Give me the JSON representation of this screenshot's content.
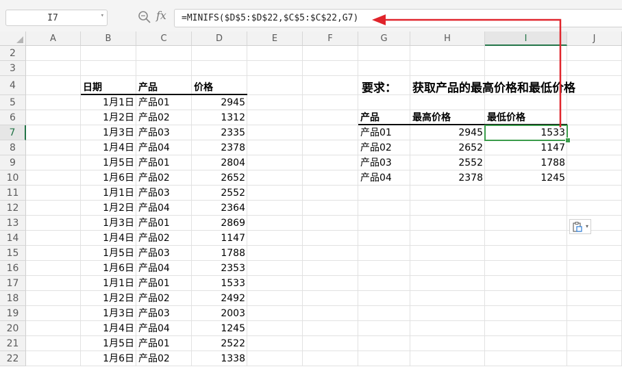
{
  "formula_bar": {
    "name_box": "I7",
    "fx_label": "fx",
    "formula": "=MINIFS($D$5:$D$22,$C$5:$C$22,G7)"
  },
  "columns": [
    "A",
    "B",
    "C",
    "D",
    "E",
    "F",
    "G",
    "H",
    "I",
    "J"
  ],
  "selected_column": "I",
  "rows": [
    "2",
    "3",
    "4",
    "5",
    "6",
    "7",
    "8",
    "9",
    "10",
    "11",
    "12",
    "13",
    "14",
    "15",
    "16",
    "17",
    "18",
    "19",
    "20",
    "21",
    "22"
  ],
  "selected_row": "7",
  "source_table": {
    "headers": [
      "日期",
      "产品",
      "价格"
    ],
    "rows": [
      [
        "1月1日",
        "产品01",
        "2945"
      ],
      [
        "1月2日",
        "产品02",
        "1312"
      ],
      [
        "1月3日",
        "产品03",
        "2335"
      ],
      [
        "1月4日",
        "产品04",
        "2378"
      ],
      [
        "1月5日",
        "产品01",
        "2804"
      ],
      [
        "1月6日",
        "产品02",
        "2652"
      ],
      [
        "1月1日",
        "产品03",
        "2552"
      ],
      [
        "1月2日",
        "产品04",
        "2364"
      ],
      [
        "1月3日",
        "产品01",
        "2869"
      ],
      [
        "1月4日",
        "产品02",
        "1147"
      ],
      [
        "1月5日",
        "产品03",
        "1788"
      ],
      [
        "1月6日",
        "产品04",
        "2353"
      ],
      [
        "1月1日",
        "产品01",
        "1533"
      ],
      [
        "1月2日",
        "产品02",
        "2492"
      ],
      [
        "1月3日",
        "产品03",
        "2003"
      ],
      [
        "1月4日",
        "产品04",
        "1245"
      ],
      [
        "1月5日",
        "产品01",
        "2522"
      ],
      [
        "1月6日",
        "产品02",
        "1338"
      ]
    ]
  },
  "requirement": {
    "label": "要求：",
    "text": "获取产品的最高价格和最低价格"
  },
  "summary_table": {
    "headers": [
      "产品",
      "最高价格",
      "最低价格"
    ],
    "rows": [
      [
        "产品01",
        "2945",
        "1533"
      ],
      [
        "产品02",
        "2652",
        "1147"
      ],
      [
        "产品03",
        "2552",
        "1788"
      ],
      [
        "产品04",
        "2378",
        "1245"
      ]
    ]
  },
  "colors": {
    "selection": "#3a9b4a",
    "arrow": "#e0242b"
  }
}
